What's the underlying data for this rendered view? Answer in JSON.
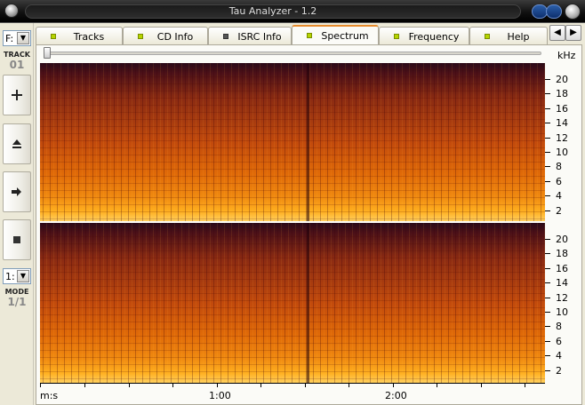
{
  "window": {
    "title": "Tau Analyzer - 1.2"
  },
  "sidebar": {
    "drive_value": "F:",
    "track_label": "TRACK",
    "track_value": "01",
    "buttons": [
      {
        "name": "add",
        "icon": "plus-icon"
      },
      {
        "name": "eject",
        "icon": "eject-icon"
      },
      {
        "name": "play",
        "icon": "arrow-right-icon"
      },
      {
        "name": "stop",
        "icon": "stop-icon"
      }
    ],
    "mode_select_value": "1:",
    "mode_label": "MODE",
    "mode_value": "1/1"
  },
  "tabs": [
    {
      "label": "Tracks",
      "active": false
    },
    {
      "label": "CD Info",
      "active": false
    },
    {
      "label": "ISRC Info",
      "active": false
    },
    {
      "label": "Spectrum",
      "active": true
    },
    {
      "label": "Frequency",
      "active": false
    },
    {
      "label": "Help",
      "active": false
    }
  ],
  "spectrum": {
    "freq_unit_label": "kHz",
    "freq_ticks": [
      "20",
      "18",
      "16",
      "14",
      "12",
      "10",
      "8",
      "6",
      "4",
      "2"
    ],
    "time_unit_label": "m:s",
    "time_labels": [
      "1:00",
      "2:00"
    ]
  },
  "colors": {
    "accent": "#e68b2c",
    "led_on": "#b6d400",
    "frame": "#ece9d8"
  }
}
